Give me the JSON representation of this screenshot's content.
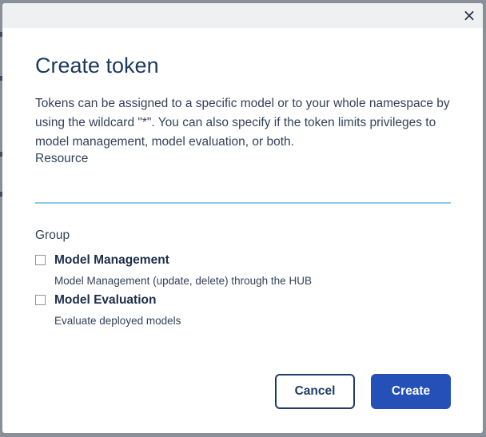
{
  "dialog": {
    "title": "Create token",
    "close_label": "×",
    "description": "Tokens can be assigned to a specific model or to your whole namespace by using the wildcard \"*\". You can also specify if the token limits privileges to model management, model evaluation, or both.",
    "resource": {
      "label": "Resource",
      "value": "",
      "placeholder": ""
    },
    "group": {
      "label": "Group",
      "options": [
        {
          "title": "Model Management",
          "description": "Model Management (update, delete) through the HUB",
          "checked": false
        },
        {
          "title": "Model Evaluation",
          "description": "Evaluate deployed models",
          "checked": false
        }
      ]
    },
    "buttons": {
      "cancel": "Cancel",
      "create": "Create"
    }
  },
  "colors": {
    "title": "#1c3a5e",
    "input_underline": "#8cc7ee",
    "primary_button": "#2450b8",
    "secondary_button_border": "#1f3b66"
  }
}
